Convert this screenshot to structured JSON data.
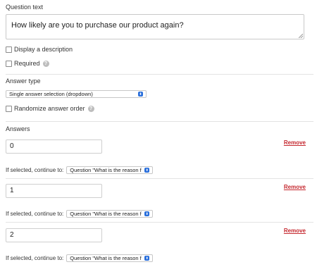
{
  "question": {
    "label": "Question text",
    "value": "How likely are you to purchase our product again?"
  },
  "options": {
    "display_description": "Display a description",
    "required": "Required",
    "help_glyph": "?"
  },
  "answer_type": {
    "label": "Answer type",
    "selected": "Single answer selection (dropdown)",
    "randomize": "Randomize answer order"
  },
  "answers": {
    "label": "Answers",
    "remove_label": "Remove",
    "continue_label": "If selected, continue to:",
    "items": [
      {
        "value": "0",
        "continue_to": "Question \"What is the reason f"
      },
      {
        "value": "1",
        "continue_to": "Question \"What is the reason f"
      },
      {
        "value": "2",
        "continue_to": "Question \"What is the reason f"
      }
    ]
  },
  "colors": {
    "remove_link": "#c5282f",
    "select_arrow": "#2a6fdb"
  }
}
